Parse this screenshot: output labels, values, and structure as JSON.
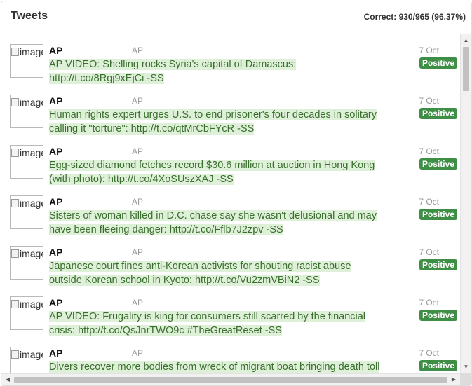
{
  "panel": {
    "title": "Tweets",
    "accuracy": "Correct: 930/965 (96.37%)"
  },
  "tweets": [
    {
      "avatar_alt": "image",
      "author": "AP",
      "handle": "AP",
      "date": "7 Oct",
      "label": "Positive",
      "lines": [
        "AP VIDEO: Shelling rocks Syria's capital of Damascus:",
        "http://t.co/8Rgj9xEjCi -SS"
      ]
    },
    {
      "avatar_alt": "image",
      "author": "AP",
      "handle": "AP",
      "date": "7 Oct",
      "label": "Positive",
      "lines": [
        "Human rights expert urges U.S. to end prisoner's four decades in solitary",
        "calling it \"torture\": http://t.co/qtMrCbFYcR -SS"
      ]
    },
    {
      "avatar_alt": "image",
      "author": "AP",
      "handle": "AP",
      "date": "7 Oct",
      "label": "Positive",
      "lines": [
        "Egg-sized diamond fetches record $30.6 million at auction in Hong Kong",
        "(with photo): http://t.co/4XoSUszXAJ -SS"
      ]
    },
    {
      "avatar_alt": "image",
      "author": "AP",
      "handle": "AP",
      "date": "7 Oct",
      "label": "Positive",
      "lines": [
        "Sisters of woman killed in D.C. chase say she wasn't delusional and may",
        "have been fleeing danger: http://t.co/Fflb7J2zpv -SS"
      ]
    },
    {
      "avatar_alt": "image",
      "author": "AP",
      "handle": "AP",
      "date": "7 Oct",
      "label": "Positive",
      "lines": [
        "Japanese court fines anti-Korean activists for shouting racist abuse",
        "outside Korean school in Kyoto: http://t.co/Vu2zmVBiN2 -SS"
      ]
    },
    {
      "avatar_alt": "image",
      "author": "AP",
      "handle": "AP",
      "date": "7 Oct",
      "label": "Positive",
      "lines": [
        "AP VIDEO: Frugality is king for consumers still scarred by the financial",
        "crisis: http://t.co/QsJnrTWO9c #TheGreatReset -SS"
      ]
    },
    {
      "avatar_alt": "image",
      "author": "AP",
      "handle": "AP",
      "date": "7 Oct",
      "label": "Positive",
      "lines": [
        "Divers recover more bodies from wreck of migrant boat bringing death toll",
        ""
      ]
    }
  ],
  "scrollbars": {
    "up_arrow": "▲",
    "down_arrow": "▼",
    "left_arrow": "◀",
    "right_arrow": "▶"
  },
  "colors": {
    "positive_label": "#3e8f45",
    "positive_highlight": "#dff0d8",
    "positive_text": "#3a6e2f"
  }
}
